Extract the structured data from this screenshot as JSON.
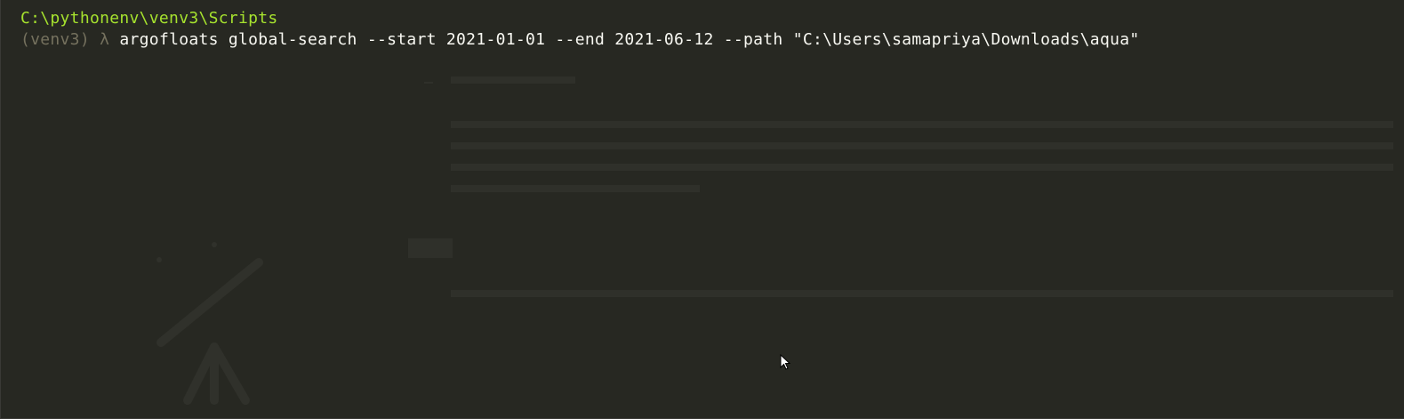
{
  "terminal": {
    "cwd": "C:\\pythonenv\\venv3\\Scripts",
    "venv": "(venv3)",
    "prompt_symbol": "λ",
    "command": "argofloats global-search --start 2021-01-01 --end 2021-06-12 --path \"C:\\Users\\samapriya\\Downloads\\aqua\""
  },
  "colors": {
    "background": "#272822",
    "cwd": "#a6e22e",
    "command": "#f8f8f2",
    "muted": "#75715e"
  },
  "icons": {
    "cursor": "mouse-pointer-icon",
    "watermark": "telescope-icon"
  }
}
